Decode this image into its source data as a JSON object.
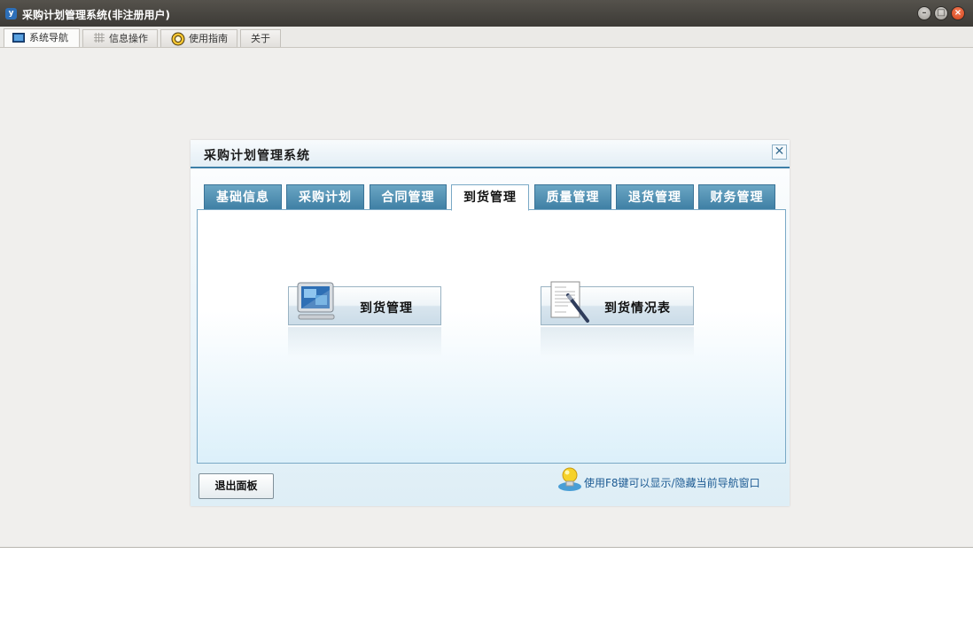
{
  "window": {
    "title": "采购计划管理系统(非注册用户)",
    "app_icon_letter": "y"
  },
  "top_tabs": [
    {
      "label": "系统导航",
      "icon": "monitor-icon",
      "active": true
    },
    {
      "label": "信息操作",
      "icon": "grid-icon",
      "active": false
    },
    {
      "label": "使用指南",
      "icon": "lifebuoy-icon",
      "active": false
    },
    {
      "label": "关于",
      "icon": "",
      "active": false
    }
  ],
  "panel": {
    "title": "采购计划管理系统",
    "close_glyph": "✕",
    "tabs": [
      {
        "label": "基础信息",
        "active": false
      },
      {
        "label": "采购计划",
        "active": false
      },
      {
        "label": "合同管理",
        "active": false
      },
      {
        "label": "到货管理",
        "active": true
      },
      {
        "label": "质量管理",
        "active": false
      },
      {
        "label": "退货管理",
        "active": false
      },
      {
        "label": "财务管理",
        "active": false
      }
    ],
    "buttons": [
      {
        "label": "到货管理",
        "icon": "computer-icon"
      },
      {
        "label": "到货情况表",
        "icon": "document-pen-icon"
      }
    ],
    "exit_label": "退出面板",
    "hint": "使用F8键可以显示/隐藏当前导航窗口",
    "hint_icon": "lightbulb-icon"
  },
  "colors": {
    "titlebar": "#3c3a36",
    "tab_blue": "#3d7ea3",
    "accent_border": "#3d7fa8",
    "hint_text": "#1d5b93",
    "close_button": "#d0421a"
  }
}
